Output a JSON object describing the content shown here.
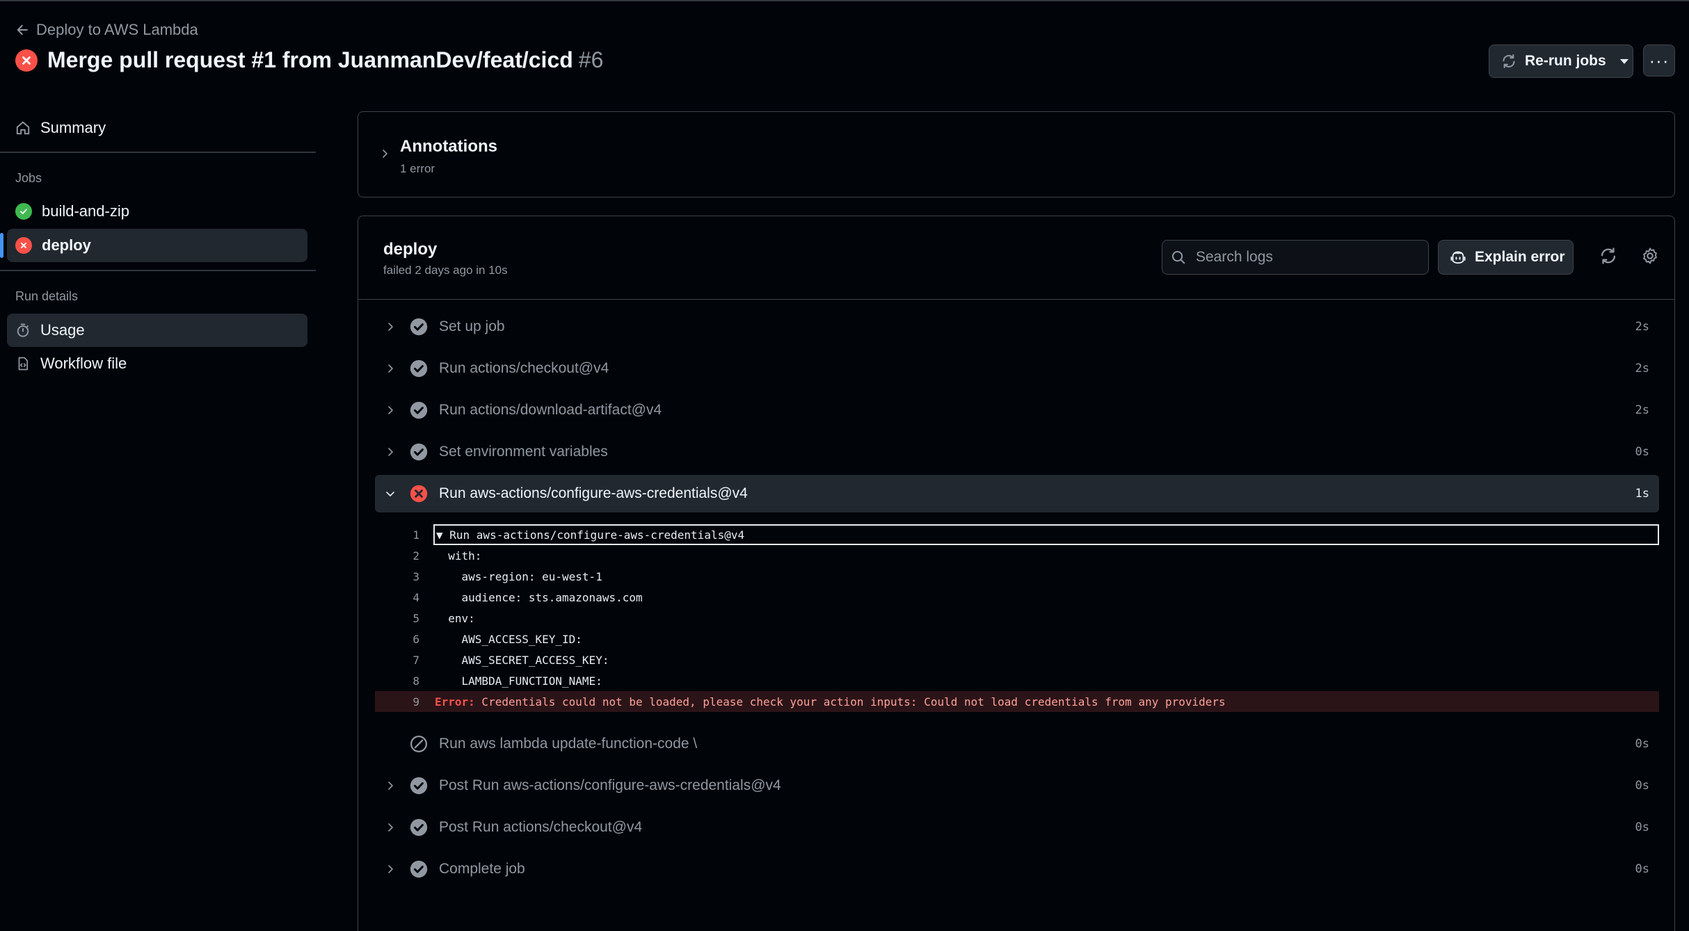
{
  "header": {
    "back_label": "Deploy to AWS Lambda",
    "title": "Merge pull request #1 from JuanmanDev/feat/cicd",
    "run_number": "#6",
    "rerun_label": "Re-run jobs",
    "more_label": "···"
  },
  "sidebar": {
    "summary_label": "Summary",
    "jobs_heading": "Jobs",
    "jobs": [
      {
        "label": "build-and-zip",
        "status": "success"
      },
      {
        "label": "deploy",
        "status": "failure"
      }
    ],
    "run_details_heading": "Run details",
    "usage_label": "Usage",
    "workflow_label": "Workflow file"
  },
  "annotations": {
    "title": "Annotations",
    "subtitle": "1 error"
  },
  "job": {
    "name": "deploy",
    "status_text": "failed 2 days ago in 10s",
    "search_placeholder": "Search logs",
    "explain_label": "Explain error"
  },
  "steps": [
    {
      "name": "Set up job",
      "time": "2s",
      "status": "success"
    },
    {
      "name": "Run actions/checkout@v4",
      "time": "2s",
      "status": "success"
    },
    {
      "name": "Run actions/download-artifact@v4",
      "time": "2s",
      "status": "success"
    },
    {
      "name": "Set environment variables",
      "time": "0s",
      "status": "success"
    },
    {
      "name": "Run aws-actions/configure-aws-credentials@v4",
      "time": "1s",
      "status": "failure"
    },
    {
      "name": "Run aws lambda update-function-code \\",
      "time": "0s",
      "status": "skipped"
    },
    {
      "name": "Post Run aws-actions/configure-aws-credentials@v4",
      "time": "0s",
      "status": "success"
    },
    {
      "name": "Post Run actions/checkout@v4",
      "time": "0s",
      "status": "success"
    },
    {
      "name": "Complete job",
      "time": "0s",
      "status": "success"
    }
  ],
  "log": [
    {
      "n": "1",
      "text": "▼ Run aws-actions/configure-aws-credentials@v4"
    },
    {
      "n": "2",
      "text": "  with:"
    },
    {
      "n": "3",
      "text": "    aws-region: eu-west-1"
    },
    {
      "n": "4",
      "text": "    audience: sts.amazonaws.com"
    },
    {
      "n": "5",
      "text": "  env:"
    },
    {
      "n": "6",
      "text": "    AWS_ACCESS_KEY_ID: "
    },
    {
      "n": "7",
      "text": "    AWS_SECRET_ACCESS_KEY: "
    },
    {
      "n": "8",
      "text": "    LAMBDA_FUNCTION_NAME: "
    },
    {
      "n": "9",
      "error_label": "Error:",
      "text": " Credentials could not be loaded, please check your action inputs: Could not load credentials from any providers"
    }
  ],
  "colors": {
    "background": "#010409",
    "panel_border": "#3d444d",
    "success": "#3fb950",
    "failure": "#f85149",
    "accent": "#4493f8"
  }
}
